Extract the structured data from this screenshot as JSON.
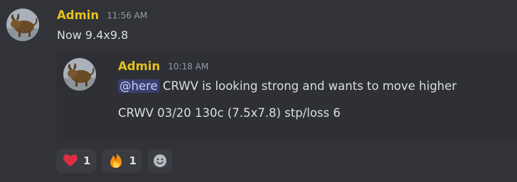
{
  "message": {
    "author": "Admin",
    "timestamp": "11:56 AM",
    "content": "Now 9.4x9.8"
  },
  "forwarded": {
    "author": "Admin",
    "timestamp": "10:18 AM",
    "mention": "@here",
    "line1_text": " CRWV is looking strong and wants to move higher",
    "line2_text": "CRWV 03/20 130c (7.5x7.8) stp/loss 6"
  },
  "reactions": [
    {
      "emoji": "heart-icon",
      "count": "1"
    },
    {
      "emoji": "fire-icon",
      "count": "1"
    }
  ],
  "colors": {
    "background": "#313338",
    "username": "#e6c11b",
    "text": "#dbdee1",
    "timestamp": "#949ba4",
    "mention_bg": "#3c4270"
  }
}
